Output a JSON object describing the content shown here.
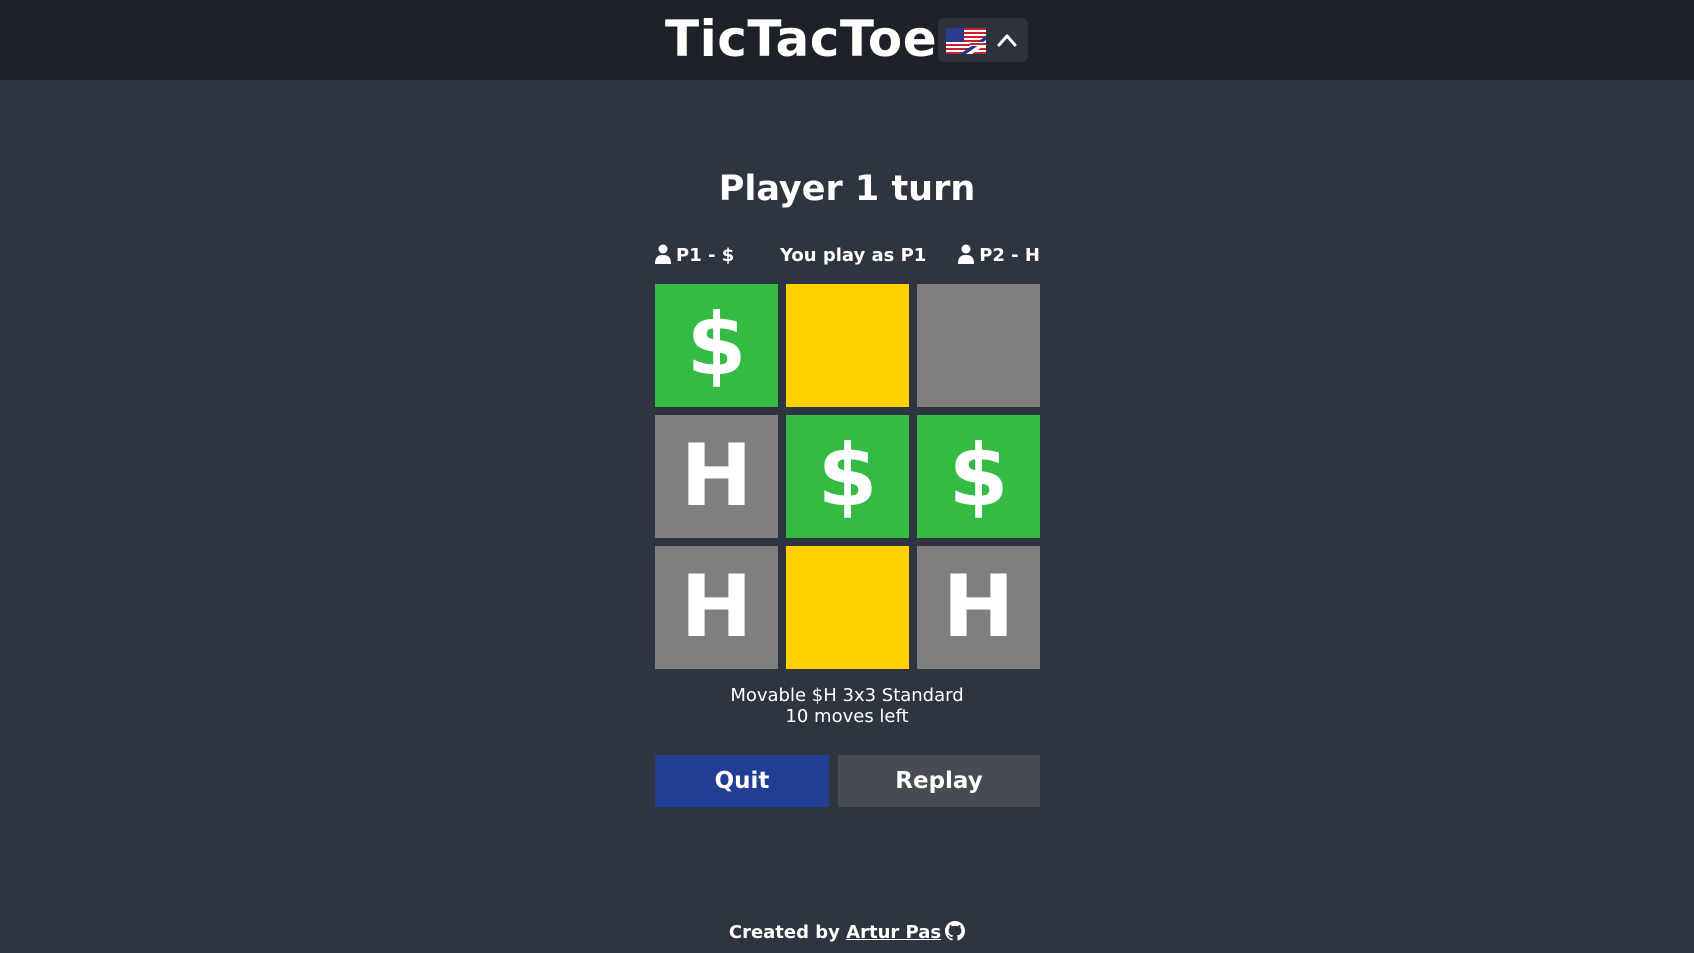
{
  "header": {
    "title": "TicTacToe",
    "language_flag": "uk-us-flag-icon",
    "dropdown_icon": "chevron-up-icon"
  },
  "game": {
    "turn_title": "Player 1 turn",
    "player1_label": "P1 - $",
    "you_label": "You play as P1",
    "player2_label": "P2 - H",
    "board": [
      {
        "symbol": "$",
        "color": "green"
      },
      {
        "symbol": "",
        "color": "yellow"
      },
      {
        "symbol": "",
        "color": "gray"
      },
      {
        "symbol": "H",
        "color": "gray"
      },
      {
        "symbol": "$",
        "color": "green"
      },
      {
        "symbol": "$",
        "color": "green"
      },
      {
        "symbol": "H",
        "color": "gray"
      },
      {
        "symbol": "",
        "color": "yellow"
      },
      {
        "symbol": "H",
        "color": "gray"
      }
    ],
    "mode_line": "Movable $H 3x3 Standard",
    "moves_left": "10 moves left"
  },
  "actions": {
    "quit_label": "Quit",
    "replay_label": "Replay"
  },
  "footer": {
    "created_by": "Created by",
    "author": "Artur Pas"
  },
  "colors": {
    "green": "#33bb44",
    "yellow": "#ffd000",
    "gray": "#7f7f7f",
    "quit": "#223e94",
    "replay": "#474b52",
    "background": "#2f3540",
    "header": "#1e2128"
  }
}
